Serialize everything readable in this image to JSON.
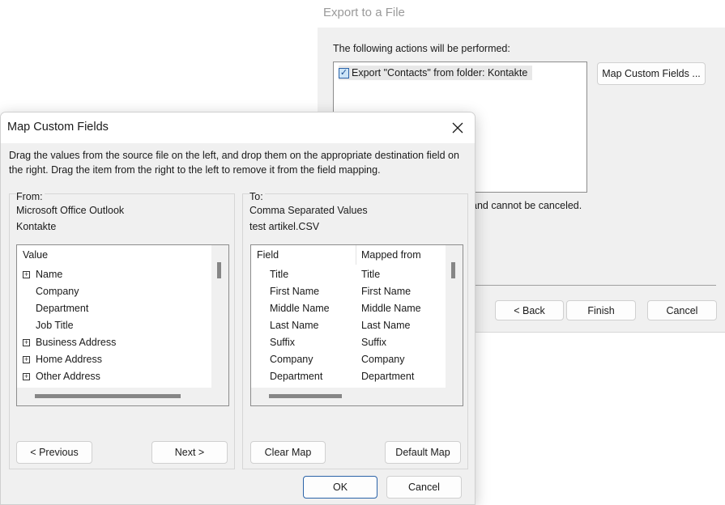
{
  "export_window": {
    "title": "Export to a File",
    "actions_label": "The following actions will be performed:",
    "actions": [
      {
        "label": "Export \"Contacts\" from folder: Kontakte",
        "checked": true
      }
    ],
    "map_custom_fields_button": "Map Custom Fields ...",
    "partial_notice": "and cannot be canceled.",
    "buttons": {
      "back": "< Back",
      "finish": "Finish",
      "cancel": "Cancel"
    }
  },
  "map_dialog": {
    "title": "Map Custom Fields",
    "close_icon": "close-icon",
    "instructions": "Drag the values from the source file on the left, and drop them on the appropriate destination field on the right.  Drag the item from the right to the left to remove it from the field mapping.",
    "from": {
      "legend": "From:",
      "source_app": "Microsoft Office Outlook",
      "source_folder": "Kontakte",
      "column_header": "Value",
      "items": [
        {
          "label": "Name",
          "expandable": true
        },
        {
          "label": "Company",
          "expandable": false
        },
        {
          "label": "Department",
          "expandable": false
        },
        {
          "label": "Job Title",
          "expandable": false
        },
        {
          "label": "Business Address",
          "expandable": true
        },
        {
          "label": "Home Address",
          "expandable": true
        },
        {
          "label": "Other Address",
          "expandable": true
        }
      ],
      "previous_button": "< Previous",
      "next_button": "Next >"
    },
    "to": {
      "legend": "To:",
      "target_format": "Comma Separated Values",
      "target_file": "test artikel.CSV",
      "columns": {
        "field": "Field",
        "mapped_from": "Mapped from"
      },
      "rows": [
        {
          "field": "Title",
          "mapped_from": "Title"
        },
        {
          "field": "First Name",
          "mapped_from": "First Name"
        },
        {
          "field": "Middle Name",
          "mapped_from": "Middle Name"
        },
        {
          "field": "Last Name",
          "mapped_from": "Last Name"
        },
        {
          "field": "Suffix",
          "mapped_from": "Suffix"
        },
        {
          "field": "Company",
          "mapped_from": "Company"
        },
        {
          "field": "Department",
          "mapped_from": "Department"
        }
      ],
      "clear_map_button": "Clear Map",
      "default_map_button": "Default Map"
    },
    "ok_button": "OK",
    "cancel_button": "Cancel"
  }
}
